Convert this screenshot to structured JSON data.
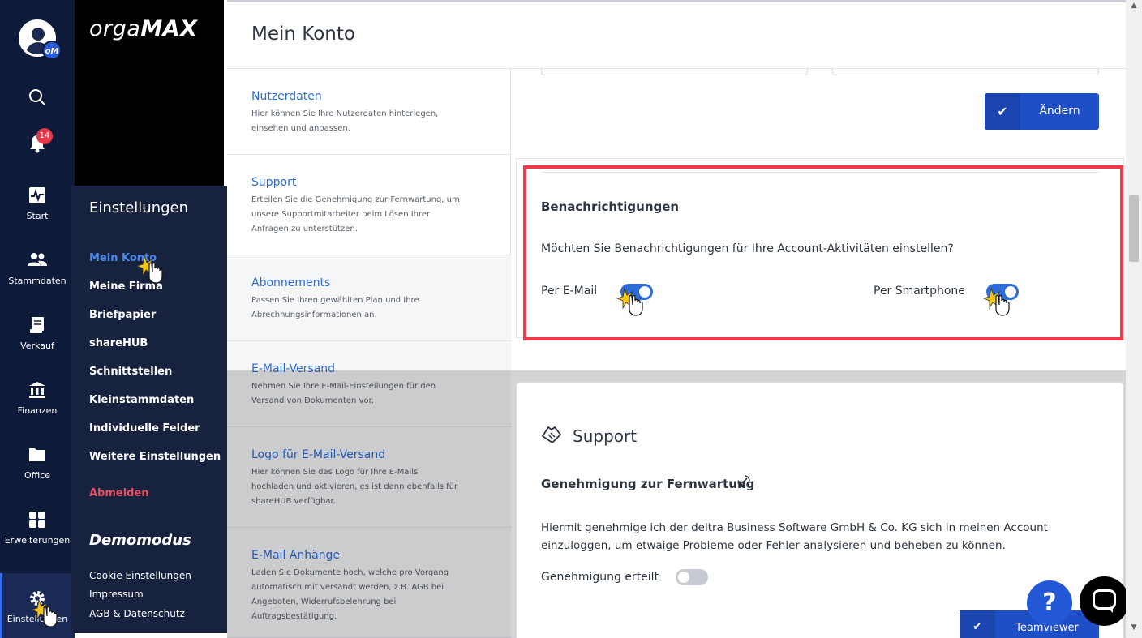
{
  "app": {
    "logo_bold": "orga",
    "logo_caps": "MAX",
    "avatar_badge": "oM",
    "notification_count": "14"
  },
  "rail": {
    "items": [
      {
        "label": "Start",
        "icon": "activity-icon"
      },
      {
        "label": "Stammdaten",
        "icon": "users-icon"
      },
      {
        "label": "Verkauf",
        "icon": "receipt-icon"
      },
      {
        "label": "Finanzen",
        "icon": "bank-icon"
      },
      {
        "label": "Office",
        "icon": "folder-icon"
      },
      {
        "label": "Erweiterungen",
        "icon": "grid-icon"
      },
      {
        "label": "Einstellungen",
        "icon": "gear-icon"
      }
    ]
  },
  "submenu": {
    "title": "Einstellungen",
    "items": [
      "Mein Konto",
      "Meine Firma",
      "Briefpapier",
      "shareHUB",
      "Schnittstellen",
      "Kleinstammdaten",
      "Individuelle Felder",
      "Weitere Einstellungen"
    ],
    "logout": "Abmelden",
    "demo_title": "Demomodus",
    "small_items": [
      "Cookie Einstellungen",
      "Impressum",
      "AGB & Datenschutz"
    ]
  },
  "header": {
    "title": "Mein Konto"
  },
  "sections": [
    {
      "title": "Nutzerdaten",
      "desc": "Hier können Sie Ihre Nutzerdaten hinterlegen, einsehen und anpassen."
    },
    {
      "title": "Support",
      "desc": "Erteilen Sie die Genehmigung zur Fernwartung, um unsere Supportmitarbeiter beim Lösen Ihrer Anfragen zu unterstützen."
    },
    {
      "title": "Abonnements",
      "desc": "Passen Sie Ihren gewählten Plan und Ihre Abrechnungsinformationen an."
    },
    {
      "title": "E-Mail-Versand",
      "desc": "Nehmen Sie Ihre E-Mail-Einstellungen für den Versand von Dokumenten vor."
    },
    {
      "title": "Logo für E-Mail-Versand",
      "desc": "Hier können Sie das Logo für Ihre E-Mails hochladen und aktivieren, es ist dann ebenfalls für shareHUB verfügbar."
    },
    {
      "title": "E-Mail Anhänge",
      "desc": "Laden Sie Dokumente hoch, welche pro Vorgang automatisch mit versandt werden, z.B. AGB bei Angeboten, Widerrufsbelehrung bei Auftragsbestätigung."
    }
  ],
  "content": {
    "change_button": "Ändern",
    "notifications": {
      "heading": "Benachrichtigungen",
      "question": "Möchten Sie Benachrichtigungen für Ihre Account-Aktivitäten einstellen?",
      "email_label": "Per E-Mail",
      "email_on": true,
      "phone_label": "Per Smartphone",
      "phone_on": true
    },
    "support": {
      "title": "Support",
      "perm_title": "Genehmigung zur Fernwartung",
      "perm_text": "Hiermit genehmige ich der deltra Business Software GmbH & Co. KG sich in meinen Account einzuloggen, um etwaige Probleme oder Fehler analysieren und beheben zu können.",
      "granted_label": "Genehmigung erteilt",
      "granted_on": false
    },
    "teamviewer_button": "Teamviewer",
    "help_glyph": "?"
  },
  "colors": {
    "rail": "#0e1a3a",
    "accent": "#2d6bd6",
    "highlight": "#ef3b4a"
  }
}
